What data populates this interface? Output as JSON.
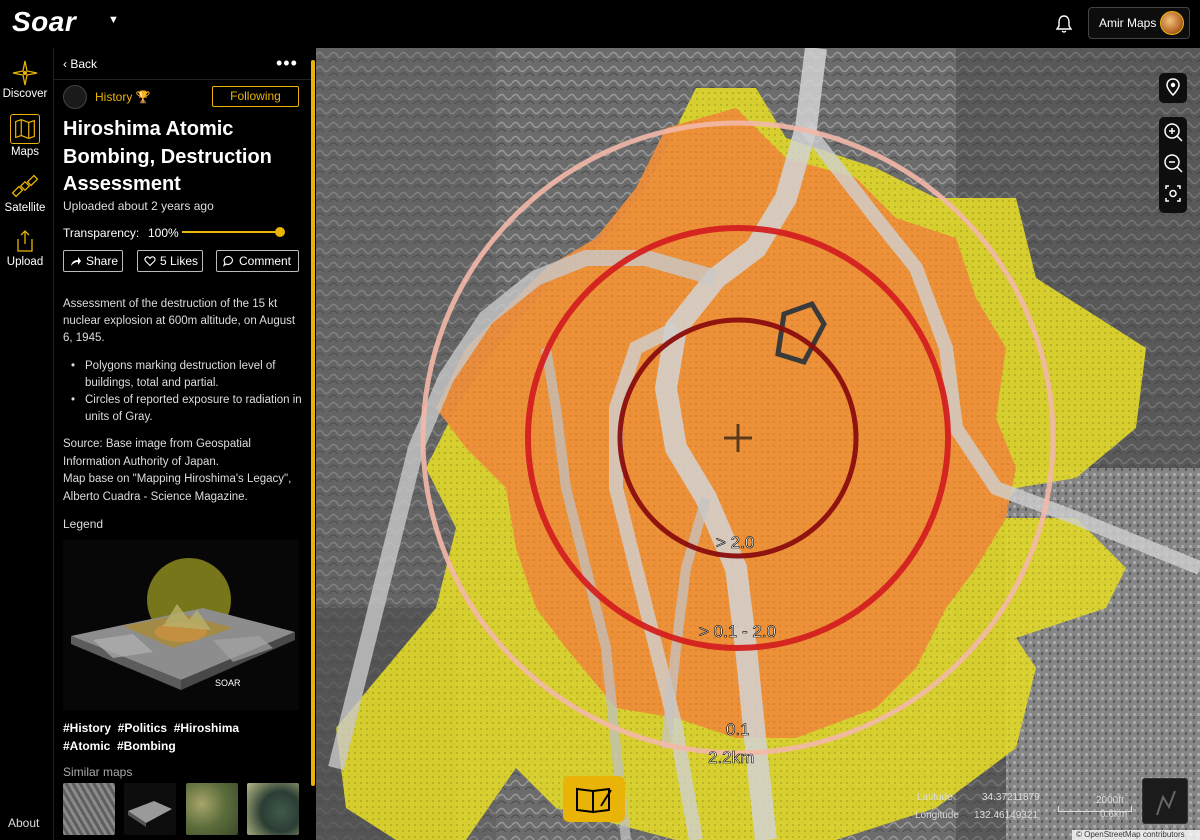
{
  "app": {
    "logo": "Soar",
    "user_name": "Amir Maps"
  },
  "nav": {
    "items": [
      {
        "label": "Discover",
        "icon": "compass-icon"
      },
      {
        "label": "Maps",
        "icon": "map-icon"
      },
      {
        "label": "Satellite",
        "icon": "satellite-icon"
      },
      {
        "label": "Upload",
        "icon": "upload-icon"
      }
    ],
    "about": "About"
  },
  "panel": {
    "back": "Back",
    "category": "History",
    "follow_label": "Following",
    "title": "Hiroshima Atomic Bombing, Destruction Assessment",
    "uploaded": "Uploaded about 2 years ago",
    "transparency_label": "Transparency:",
    "transparency_value": "100%",
    "transparency_fraction": 1.0,
    "share_label": "Share",
    "likes_label": "5 Likes",
    "comment_label": "Comment",
    "description": "Assessment of the destruction of the 15 kt nuclear explosion at 600m altitude, on August 6, 1945.",
    "bullets": [
      "Polygons marking destruction level of buildings, total and partial.",
      "Circles of reported exposure to radiation in units of Gray."
    ],
    "source_line1": "Source: Base image from Geospatial Information Authority of Japan.",
    "source_line2": "Map base on \"Mapping Hiroshima's Legacy\", Alberto Cuadra - Science Magazine.",
    "legend_label": "Legend",
    "legend_watermark": "SOAR",
    "tags_line1": "#History  #Politics  #Hiroshima",
    "tags_line2": "#Atomic  #Bombing",
    "similar_label": "Similar maps"
  },
  "map": {
    "ring_labels": [
      "> 2.0",
      "> 0.1 - 2.0",
      "0.1",
      "2.2km"
    ],
    "latitude_label": "Latitude",
    "latitude_value": "34.37211879",
    "longitude_label": "Longitude",
    "longitude_value": "132.46149321",
    "scale_ft": "2000ft",
    "scale_km": "0.6km",
    "attribution": "© OpenStreetMap contributors"
  },
  "colors": {
    "accent": "#eab308",
    "total_destruction": "#f0913a",
    "partial_destruction": "#e3dc2a",
    "ring_inner": "#8a0d0d",
    "ring_mid": "#d42020",
    "ring_outer": "#f3b8a8"
  }
}
